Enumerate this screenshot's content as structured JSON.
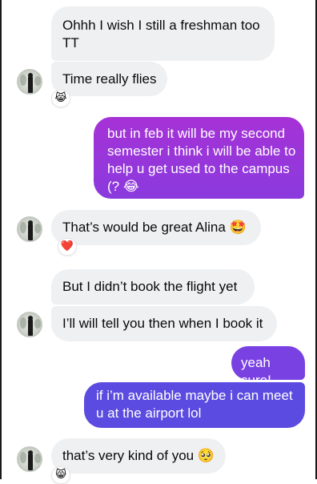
{
  "messages": [
    {
      "id": "m1",
      "from": "them",
      "text": "Ohhh I wish I still a freshman too TT"
    },
    {
      "id": "m2",
      "from": "them",
      "text": "Time really flies",
      "reaction": "😹"
    },
    {
      "id": "m3",
      "from": "me",
      "text": "but in feb it will be my second semester i think i will be able to help u get used to the campus (?",
      "trailing_emoji": "😂"
    },
    {
      "id": "m4",
      "from": "them",
      "text": "That’s would be great Alina",
      "trailing_emoji": "🤩",
      "reaction": "❤️"
    },
    {
      "id": "m5",
      "from": "them",
      "text": "But I didn’t book the flight yet"
    },
    {
      "id": "m6",
      "from": "them",
      "text": "I’ll will tell you then when I book it"
    },
    {
      "id": "m7",
      "from": "me",
      "text": "yeah sure!"
    },
    {
      "id": "m8",
      "from": "me",
      "text": "if i’m available maybe i can meet u at the airport lol"
    },
    {
      "id": "m9",
      "from": "them",
      "text": "that’s very kind of you",
      "trailing_emoji": "🥺",
      "reaction": "😸"
    }
  ],
  "colors": {
    "received_bubble": "#eff0f2",
    "sent_gradient_top": "#a632d6",
    "sent_gradient_bottom": "#5b4be0"
  },
  "icons": {
    "avatar": "contact-avatar-photo"
  }
}
